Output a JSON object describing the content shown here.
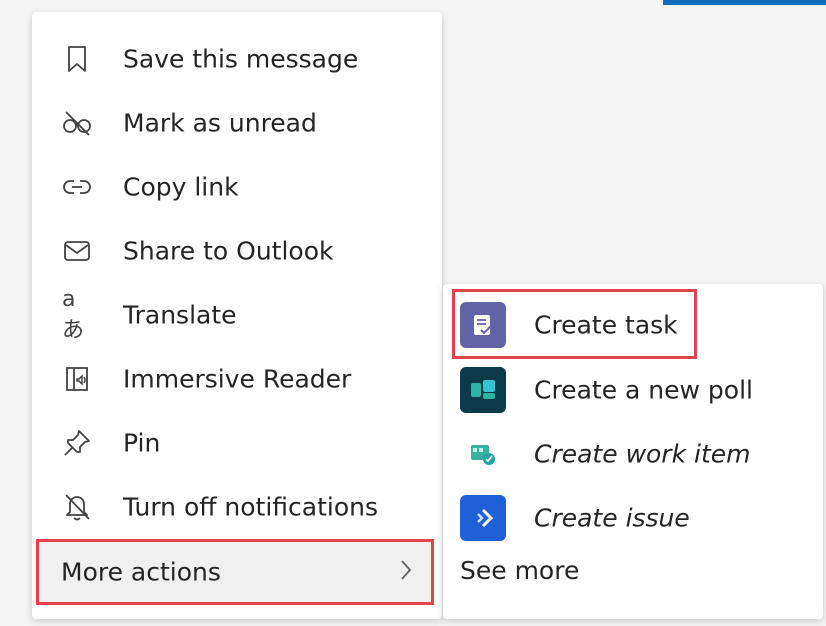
{
  "context_menu": {
    "items": [
      {
        "label": "Save this message",
        "icon": "bookmark-icon"
      },
      {
        "label": "Mark as unread",
        "icon": "unread-icon"
      },
      {
        "label": "Copy link",
        "icon": "link-icon"
      },
      {
        "label": "Share to Outlook",
        "icon": "mail-icon"
      },
      {
        "label": "Translate",
        "icon": "translate-icon"
      },
      {
        "label": "Immersive Reader",
        "icon": "immersive-reader-icon"
      },
      {
        "label": "Pin",
        "icon": "pin-icon"
      },
      {
        "label": "Turn off notifications",
        "icon": "notifications-off-icon"
      }
    ],
    "more_actions": {
      "label": "More actions",
      "icon": "chevron-right-icon"
    }
  },
  "submenu": {
    "items": [
      {
        "label": "Create task",
        "icon": "tasks-app-icon",
        "color": "#6264a7"
      },
      {
        "label": "Create a new poll",
        "icon": "polls-app-icon",
        "color": "#0b3a48"
      },
      {
        "label": "Create work item",
        "icon": "work-item-app-icon",
        "color": "#37b2a0"
      },
      {
        "label": "Create issue",
        "icon": "issue-app-icon",
        "color": "#1f5fd8"
      }
    ],
    "see_more": "See more"
  },
  "colors": {
    "highlight": "#e1444b",
    "accent": "#0f6cbd"
  }
}
